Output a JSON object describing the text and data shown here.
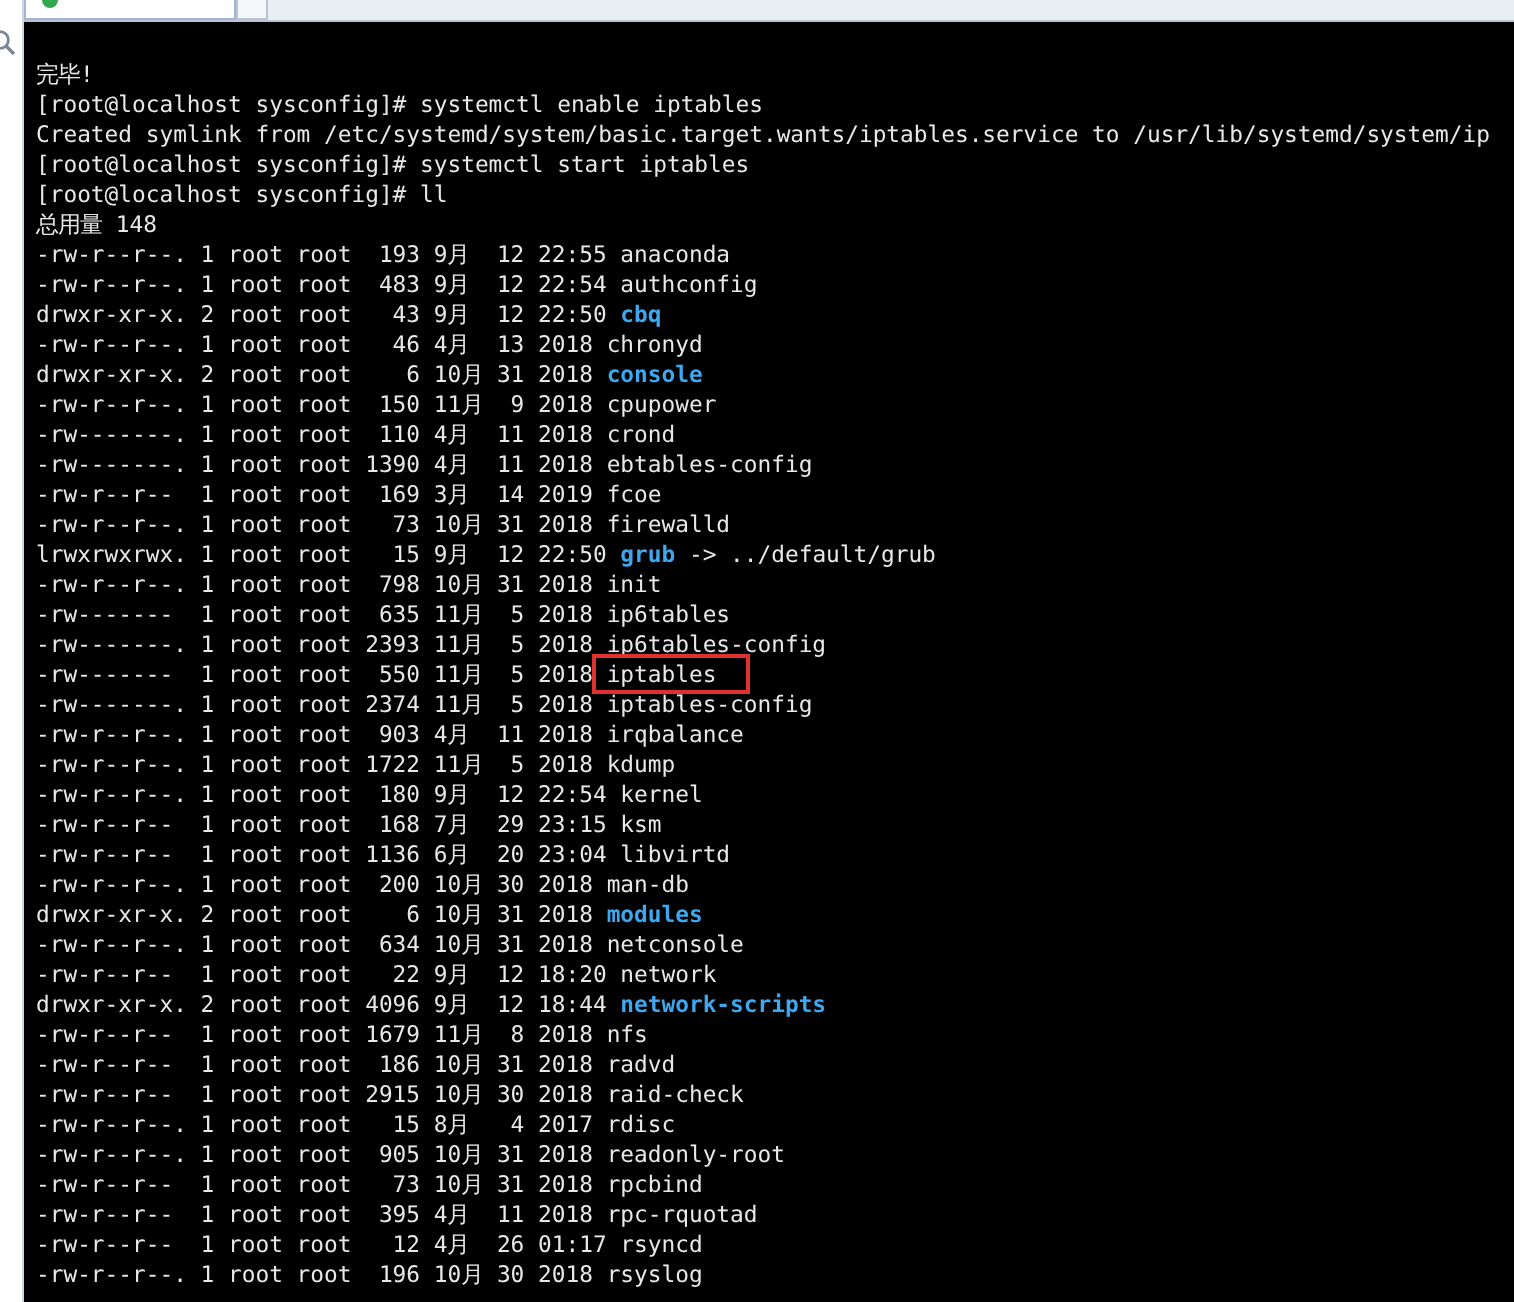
{
  "terminal": {
    "lines": [
      {
        "kind": "plain",
        "text": "完毕!"
      },
      {
        "kind": "plain",
        "text": "[root@localhost sysconfig]# systemctl enable iptables"
      },
      {
        "kind": "plain",
        "text": "Created symlink from /etc/systemd/system/basic.target.wants/iptables.service to /usr/lib/systemd/system/ip"
      },
      {
        "kind": "plain",
        "text": "[root@localhost sysconfig]# systemctl start iptables"
      },
      {
        "kind": "plain",
        "text": "[root@localhost sysconfig]# ll"
      },
      {
        "kind": "plain",
        "text": "总用量 148"
      },
      {
        "kind": "file",
        "info": "-rw-r--r--. 1 root root  193 9月  12 22:55",
        "name": "anaconda",
        "highlighted": false
      },
      {
        "kind": "file",
        "info": "-rw-r--r--. 1 root root  483 9月  12 22:54",
        "name": "authconfig",
        "highlighted": false
      },
      {
        "kind": "dir",
        "info": "drwxr-xr-x. 2 root root   43 9月  12 22:50",
        "name": "cbq",
        "highlighted": false
      },
      {
        "kind": "file",
        "info": "-rw-r--r--. 1 root root   46 4月  13 2018",
        "name": "chronyd",
        "highlighted": false
      },
      {
        "kind": "dir",
        "info": "drwxr-xr-x. 2 root root    6 10月 31 2018",
        "name": "console",
        "highlighted": false
      },
      {
        "kind": "file",
        "info": "-rw-r--r--. 1 root root  150 11月  9 2018",
        "name": "cpupower",
        "highlighted": false
      },
      {
        "kind": "file",
        "info": "-rw-------. 1 root root  110 4月  11 2018",
        "name": "crond",
        "highlighted": false
      },
      {
        "kind": "file",
        "info": "-rw-------. 1 root root 1390 4月  11 2018",
        "name": "ebtables-config",
        "highlighted": false
      },
      {
        "kind": "file",
        "info": "-rw-r--r--  1 root root  169 3月  14 2019",
        "name": "fcoe",
        "highlighted": false
      },
      {
        "kind": "file",
        "info": "-rw-r--r--. 1 root root   73 10月 31 2018",
        "name": "firewalld",
        "highlighted": false
      },
      {
        "kind": "link",
        "info": "lrwxrwxrwx. 1 root root   15 9月  12 22:50",
        "name": "grub",
        "target": "-> ../default/grub",
        "highlighted": false
      },
      {
        "kind": "file",
        "info": "-rw-r--r--. 1 root root  798 10月 31 2018",
        "name": "init",
        "highlighted": false
      },
      {
        "kind": "file",
        "info": "-rw-------  1 root root  635 11月  5 2018",
        "name": "ip6tables",
        "highlighted": false
      },
      {
        "kind": "file",
        "info": "-rw-------. 1 root root 2393 11月  5 2018",
        "name": "ip6tables-config",
        "highlighted": false
      },
      {
        "kind": "file",
        "info": "-rw-------  1 root root  550 11月  5 2018",
        "name": "iptables",
        "highlighted": true
      },
      {
        "kind": "file",
        "info": "-rw-------. 1 root root 2374 11月  5 2018",
        "name": "iptables-config",
        "highlighted": false
      },
      {
        "kind": "file",
        "info": "-rw-r--r--. 1 root root  903 4月  11 2018",
        "name": "irqbalance",
        "highlighted": false
      },
      {
        "kind": "file",
        "info": "-rw-r--r--. 1 root root 1722 11月  5 2018",
        "name": "kdump",
        "highlighted": false
      },
      {
        "kind": "file",
        "info": "-rw-r--r--. 1 root root  180 9月  12 22:54",
        "name": "kernel",
        "highlighted": false
      },
      {
        "kind": "file",
        "info": "-rw-r--r--  1 root root  168 7月  29 23:15",
        "name": "ksm",
        "highlighted": false
      },
      {
        "kind": "file",
        "info": "-rw-r--r--  1 root root 1136 6月  20 23:04",
        "name": "libvirtd",
        "highlighted": false
      },
      {
        "kind": "file",
        "info": "-rw-r--r--. 1 root root  200 10月 30 2018",
        "name": "man-db",
        "highlighted": false
      },
      {
        "kind": "dir",
        "info": "drwxr-xr-x. 2 root root    6 10月 31 2018",
        "name": "modules",
        "highlighted": false
      },
      {
        "kind": "file",
        "info": "-rw-r--r--. 1 root root  634 10月 31 2018",
        "name": "netconsole",
        "highlighted": false
      },
      {
        "kind": "file",
        "info": "-rw-r--r--  1 root root   22 9月  12 18:20",
        "name": "network",
        "highlighted": false
      },
      {
        "kind": "dir",
        "info": "drwxr-xr-x. 2 root root 4096 9月  12 18:44",
        "name": "network-scripts",
        "highlighted": false
      },
      {
        "kind": "file",
        "info": "-rw-r--r--  1 root root 1679 11月  8 2018",
        "name": "nfs",
        "highlighted": false
      },
      {
        "kind": "file",
        "info": "-rw-r--r--  1 root root  186 10月 31 2018",
        "name": "radvd",
        "highlighted": false
      },
      {
        "kind": "file",
        "info": "-rw-r--r--  1 root root 2915 10月 30 2018",
        "name": "raid-check",
        "highlighted": false
      },
      {
        "kind": "file",
        "info": "-rw-r--r--. 1 root root   15 8月   4 2017",
        "name": "rdisc",
        "highlighted": false
      },
      {
        "kind": "file",
        "info": "-rw-r--r--. 1 root root  905 10月 31 2018",
        "name": "readonly-root",
        "highlighted": false
      },
      {
        "kind": "file",
        "info": "-rw-r--r--  1 root root   73 10月 31 2018",
        "name": "rpcbind",
        "highlighted": false
      },
      {
        "kind": "file",
        "info": "-rw-r--r--  1 root root  395 4月  11 2018",
        "name": "rpc-rquotad",
        "highlighted": false
      },
      {
        "kind": "file",
        "info": "-rw-r--r--  1 root root   12 4月  26 01:17",
        "name": "rsyncd",
        "highlighted": false
      },
      {
        "kind": "file",
        "info": "-rw-r--r--. 1 root root  196 10月 30 2018",
        "name": "rsyslog",
        "highlighted": false
      }
    ]
  }
}
